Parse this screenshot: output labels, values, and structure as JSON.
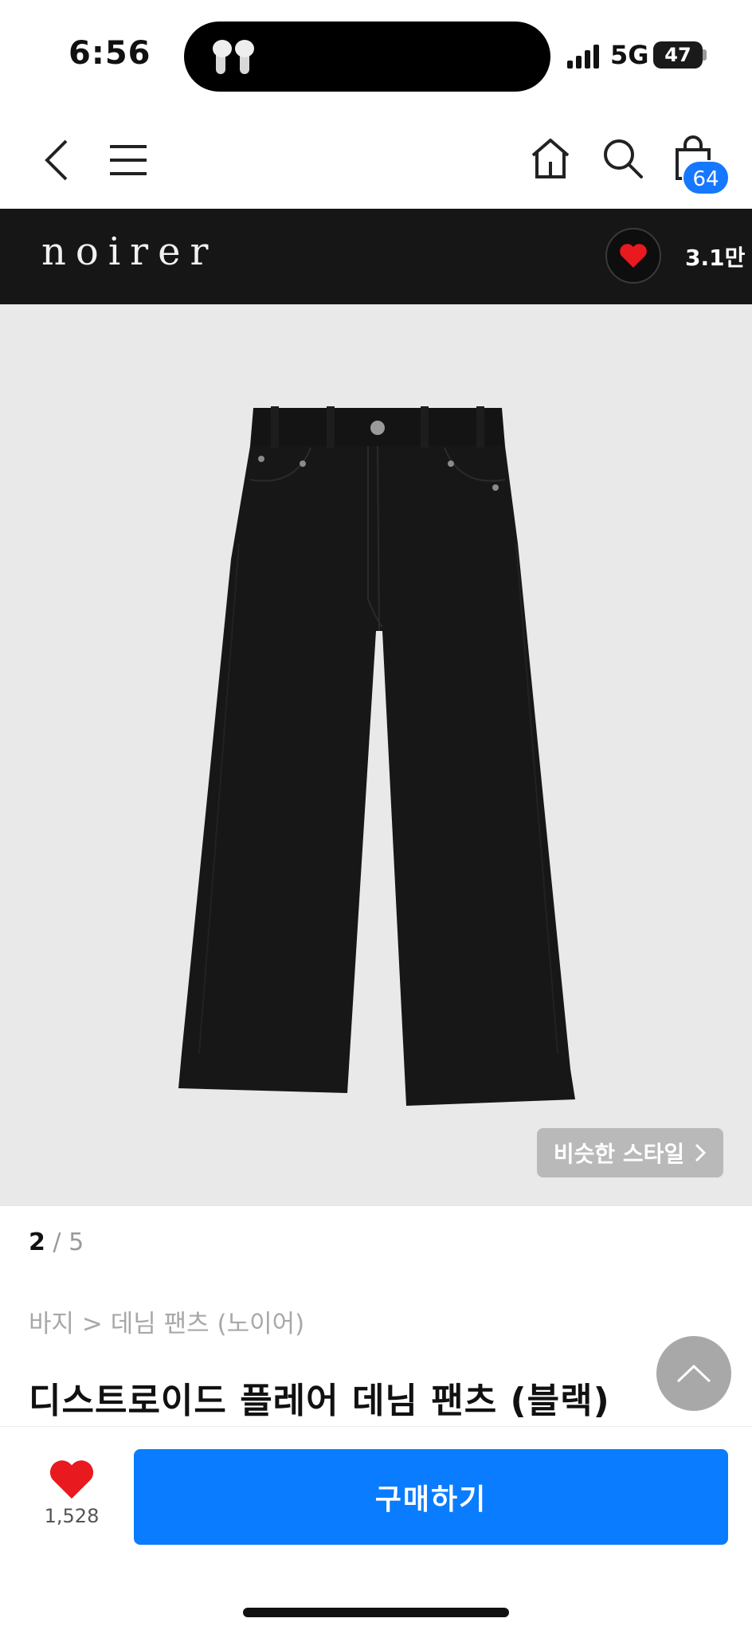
{
  "status_bar": {
    "time": "6:56",
    "network": "5G",
    "battery": "47"
  },
  "nav": {
    "cart_count": "64"
  },
  "brand": {
    "name": "noirer",
    "like_count": "3.1만"
  },
  "product": {
    "similar_style_label": "비슷한 스타일",
    "page_current": "2",
    "page_total": "5",
    "breadcrumb": "바지 > 데님 팬츠 (노이어)",
    "title": "디스트로이드 플레어 데님 팬츠 (블랙)"
  },
  "bottom": {
    "like_count": "1,528",
    "buy_label": "구매하기"
  },
  "colors": {
    "accent_blue": "#0a7cff",
    "heart_red": "#e8191f",
    "brand_bar": "#161616"
  }
}
